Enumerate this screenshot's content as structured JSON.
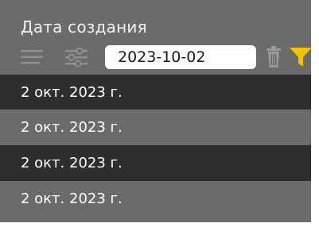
{
  "column": {
    "title": "Дата создания"
  },
  "toolbar": {
    "icons": {
      "list": "list-lines-icon",
      "settings": "filter-settings-icon",
      "delete": "trash-icon",
      "filter": "filter-funnel-icon"
    },
    "date_value": "2023-10-02"
  },
  "rows": [
    {
      "value": "2 окт. 2023 г."
    },
    {
      "value": "2 окт. 2023 г."
    },
    {
      "value": "2 окт. 2023 г."
    },
    {
      "value": "2 окт. 2023 г."
    }
  ],
  "colors": {
    "header_bg": "#6b6b6b",
    "row_dark": "#2e2e2e",
    "row_light": "#6b6b6b",
    "filter_active": "#f2c200",
    "icon_muted": "#9a9a9a"
  }
}
